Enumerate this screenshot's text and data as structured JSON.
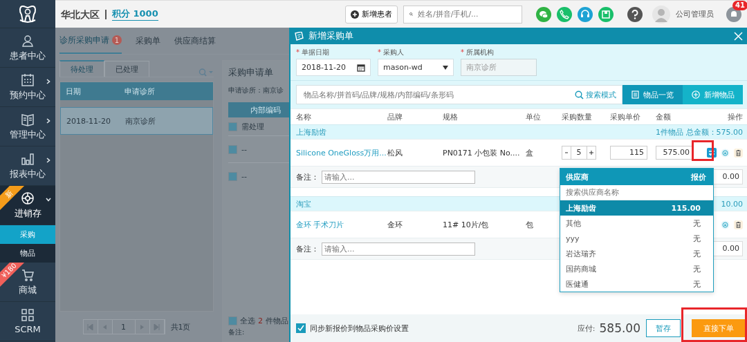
{
  "sidebar": {
    "items": [
      {
        "label": "患者中心",
        "kind": "link",
        "selected": false
      },
      {
        "label": "预约中心",
        "kind": "group",
        "expanded": false,
        "selected": false
      },
      {
        "label": "管理中心",
        "kind": "group",
        "expanded": false,
        "selected": false
      },
      {
        "label": "报表中心",
        "kind": "group",
        "expanded": false,
        "selected": false
      },
      {
        "label": "进销存",
        "kind": "group",
        "expanded": true,
        "selected": true,
        "ribbon": {
          "text": "新",
          "color": "#f59c1a"
        },
        "children": [
          {
            "label": "采购",
            "selected": true
          },
          {
            "label": "物品",
            "selected": false
          }
        ]
      },
      {
        "label": "商城",
        "kind": "link",
        "selected": false,
        "ribbon": {
          "text": "¥180",
          "color": "#f0605a"
        }
      },
      {
        "label": "SCRM",
        "kind": "link",
        "selected": false
      }
    ]
  },
  "topbar": {
    "region": "华北大区",
    "points": "积分 1000",
    "new_patient_button": "新增患者",
    "search": {
      "placeholder": "姓名/拼音/手机/..."
    },
    "user": "公司管理员",
    "notification_count": "41"
  },
  "background": {
    "tabs": [
      {
        "label": "诊所采购申请",
        "badge": "1",
        "selected": true
      },
      {
        "label": "采购单",
        "selected": false
      },
      {
        "label": "供应商结算",
        "selected": false
      }
    ],
    "subtabs": [
      {
        "label": "待处理",
        "selected": true
      },
      {
        "label": "已处理",
        "selected": false
      }
    ],
    "list_columns": [
      "日期",
      "申请诊所"
    ],
    "list_rows": [
      {
        "date": "2018-11-20",
        "clinic": "南京诊所",
        "selected": true
      }
    ],
    "pagination": {
      "page": "1",
      "total": "共1页"
    },
    "detail": {
      "title": "采购申请单",
      "clinic": "申请诊所：南京诊",
      "code_button": "内部编码",
      "group": {
        "label": "需处理",
        "checked": true
      },
      "rows": [
        {
          "text": "--",
          "checked": true
        },
        {
          "text": "--",
          "checked": true
        }
      ],
      "select_all": {
        "label": "全选",
        "count": "2",
        "suffix": "件物品",
        "checked": true
      },
      "remark": "备注:"
    }
  },
  "drawer": {
    "title": "新增采购单",
    "fields": [
      {
        "label": "单据日期",
        "required_mark": "*",
        "kind": "date",
        "value": "2018-11-20",
        "disabled": false
      },
      {
        "label": "采购人",
        "required_mark": "*",
        "kind": "select",
        "value": "mason-wd",
        "disabled": false
      },
      {
        "label": "所属机构",
        "required_mark": "*",
        "kind": "text",
        "value": "南京诊所",
        "disabled": true
      }
    ],
    "item_search": {
      "placeholder": "物品名称/拼首码/品牌/规格/内部编码/条形码",
      "mode_link": "搜索模式"
    },
    "buttons": [
      {
        "label": "物品一览",
        "kind": "list"
      },
      {
        "label": "新增物品",
        "kind": "add"
      }
    ],
    "columns": [
      "名称",
      "品牌",
      "规格",
      "单位",
      "采购数量",
      "采购单价",
      "金额",
      "操作"
    ],
    "groups": [
      {
        "supplier": "上海励齿",
        "summary": "1件物品 总金额：575.00",
        "items": [
          {
            "name": "Silicone OneGloss万用...",
            "brand": "松风",
            "spec": "PN0171 小包装 No....",
            "unit": "盒",
            "qty": "5",
            "price": "115",
            "amount": "575.00",
            "has_swap": true
          }
        ],
        "remark_placeholder": "请输入...",
        "remark_label": "备注：",
        "discount": "0.00"
      },
      {
        "supplier": "淘宝",
        "summary": "10.00",
        "items": [
          {
            "name": "金环 手术刀片",
            "brand": "金环",
            "spec": "11# 10片/包",
            "unit": "包",
            "has_swap": false
          }
        ],
        "remark_placeholder": "请输入...",
        "remark_label": "备注：",
        "discount": "0.00"
      }
    ],
    "supplier_menu": {
      "columns": [
        "供应商",
        "报价"
      ],
      "placeholder": "搜索供应商名称",
      "options": [
        {
          "name": "上海励齿",
          "price": "115.00",
          "selected": true
        },
        {
          "name": "其他",
          "price": "无",
          "selected": false
        },
        {
          "name": "yyy",
          "price": "无",
          "selected": false
        },
        {
          "name": "岩达瑞齐",
          "price": "无",
          "selected": false
        },
        {
          "name": "国药商城",
          "price": "无",
          "selected": false
        },
        {
          "name": "医健通",
          "price": "无",
          "selected": false
        }
      ]
    },
    "sync_option": {
      "label": "同步新报价到物品采购价设置",
      "checked": true
    },
    "payable_label": "应付:",
    "payable": "585.00",
    "save_button": "暂存",
    "submit_button": "直接下单"
  }
}
